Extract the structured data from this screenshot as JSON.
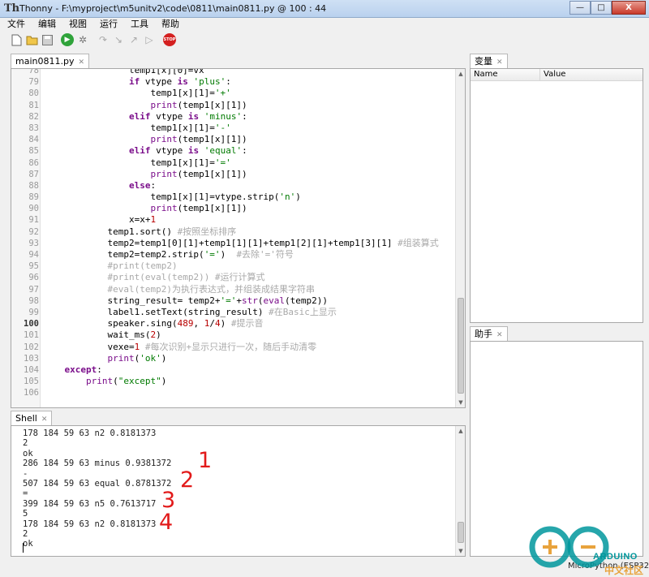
{
  "window": {
    "app_name": "Thonny",
    "title": "Thonny  -  F:\\myproject\\m5unitv2\\code\\0811\\main0811.py  @  100 : 44",
    "minimize": "—",
    "maximize": "□",
    "close": "X"
  },
  "menu": [
    "文件",
    "编辑",
    "视图",
    "运行",
    "工具",
    "帮助"
  ],
  "toolbar": {
    "new": "new-file-icon",
    "open": "open-file-icon",
    "save": "save-icon",
    "run": "run-icon",
    "debug": "debug-icon",
    "step_over": "step-over-icon",
    "step_into": "step-into-icon",
    "step_out": "step-out-icon",
    "resume": "resume-icon",
    "stop_label": "STOP"
  },
  "editor": {
    "tab_label": "main0811.py",
    "current_line": "100",
    "lines": [
      {
        "n": "78",
        "tokens": [
          [
            "plain",
            "                temp1[x][0]=vx"
          ]
        ]
      },
      {
        "n": "79",
        "tokens": [
          [
            "plain",
            "                "
          ],
          [
            "kw",
            "if"
          ],
          [
            "plain",
            " vtype "
          ],
          [
            "kw",
            "is"
          ],
          [
            "plain",
            " "
          ],
          [
            "str",
            "'plus'"
          ],
          [
            "plain",
            ":"
          ]
        ]
      },
      {
        "n": "80",
        "tokens": [
          [
            "plain",
            "                    temp1[x][1]="
          ],
          [
            "str",
            "'+'"
          ]
        ]
      },
      {
        "n": "81",
        "tokens": [
          [
            "plain",
            "                    "
          ],
          [
            "builtin",
            "print"
          ],
          [
            "plain",
            "(temp1[x][1])"
          ]
        ]
      },
      {
        "n": "82",
        "tokens": [
          [
            "plain",
            "                "
          ],
          [
            "kw",
            "elif"
          ],
          [
            "plain",
            " vtype "
          ],
          [
            "kw",
            "is"
          ],
          [
            "plain",
            " "
          ],
          [
            "str",
            "'minus'"
          ],
          [
            "plain",
            ":"
          ]
        ]
      },
      {
        "n": "83",
        "tokens": [
          [
            "plain",
            "                    temp1[x][1]="
          ],
          [
            "str",
            "'-'"
          ]
        ]
      },
      {
        "n": "84",
        "tokens": [
          [
            "plain",
            "                    "
          ],
          [
            "builtin",
            "print"
          ],
          [
            "plain",
            "(temp1[x][1])"
          ]
        ]
      },
      {
        "n": "85",
        "tokens": [
          [
            "plain",
            "                "
          ],
          [
            "kw",
            "elif"
          ],
          [
            "plain",
            " vtype "
          ],
          [
            "kw",
            "is"
          ],
          [
            "plain",
            " "
          ],
          [
            "str",
            "'equal'"
          ],
          [
            "plain",
            ":"
          ]
        ]
      },
      {
        "n": "86",
        "tokens": [
          [
            "plain",
            "                    temp1[x][1]="
          ],
          [
            "str",
            "'='"
          ]
        ]
      },
      {
        "n": "87",
        "tokens": [
          [
            "plain",
            "                    "
          ],
          [
            "builtin",
            "print"
          ],
          [
            "plain",
            "(temp1[x][1])"
          ]
        ]
      },
      {
        "n": "88",
        "tokens": [
          [
            "plain",
            "                "
          ],
          [
            "kw",
            "else"
          ],
          [
            "plain",
            ":"
          ]
        ]
      },
      {
        "n": "89",
        "tokens": [
          [
            "plain",
            "                    temp1[x][1]=vtype.strip("
          ],
          [
            "str",
            "'n'"
          ],
          [
            "plain",
            ")"
          ]
        ]
      },
      {
        "n": "90",
        "tokens": [
          [
            "plain",
            "                    "
          ],
          [
            "builtin",
            "print"
          ],
          [
            "plain",
            "(temp1[x][1])"
          ]
        ]
      },
      {
        "n": "91",
        "tokens": [
          [
            "plain",
            "                x=x+"
          ],
          [
            "num",
            "1"
          ]
        ]
      },
      {
        "n": "92",
        "tokens": [
          [
            "plain",
            "            temp1.sort() "
          ],
          [
            "cmt",
            "#按照坐标排序"
          ]
        ]
      },
      {
        "n": "93",
        "tokens": [
          [
            "plain",
            "            temp2=temp1[0][1]+temp1[1][1]+temp1[2][1]+temp1[3][1] "
          ],
          [
            "cmt",
            "#组装算式"
          ]
        ]
      },
      {
        "n": "94",
        "tokens": [
          [
            "plain",
            "            temp2=temp2.strip("
          ],
          [
            "str",
            "'='"
          ],
          [
            "plain",
            ")  "
          ],
          [
            "cmt",
            "#去除'='符号"
          ]
        ]
      },
      {
        "n": "95",
        "tokens": [
          [
            "plain",
            "            "
          ],
          [
            "cmt",
            "#print(temp2)"
          ]
        ]
      },
      {
        "n": "96",
        "tokens": [
          [
            "plain",
            "            "
          ],
          [
            "cmt",
            "#print(eval(temp2)) #运行计算式"
          ]
        ]
      },
      {
        "n": "97",
        "tokens": [
          [
            "plain",
            "            "
          ],
          [
            "cmt",
            "#eval(temp2)为执行表达式，并组装成结果字符串"
          ]
        ]
      },
      {
        "n": "98",
        "tokens": [
          [
            "plain",
            "            string_result= temp2+"
          ],
          [
            "str",
            "'='"
          ],
          [
            "plain",
            "+"
          ],
          [
            "builtin",
            "str"
          ],
          [
            "plain",
            "("
          ],
          [
            "builtin",
            "eval"
          ],
          [
            "plain",
            "(temp2))"
          ]
        ]
      },
      {
        "n": "99",
        "tokens": [
          [
            "plain",
            "            label1.setText(string_result) "
          ],
          [
            "cmt",
            "#在Basic上显示"
          ]
        ]
      },
      {
        "n": "100",
        "tokens": [
          [
            "plain",
            "            speaker.sing("
          ],
          [
            "num",
            "489"
          ],
          [
            "plain",
            ", "
          ],
          [
            "num",
            "1"
          ],
          [
            "plain",
            "/"
          ],
          [
            "num",
            "4"
          ],
          [
            "plain",
            ") "
          ],
          [
            "cmt",
            "#提示音"
          ]
        ]
      },
      {
        "n": "101",
        "tokens": [
          [
            "plain",
            "            wait_ms("
          ],
          [
            "num",
            "2"
          ],
          [
            "plain",
            ")"
          ]
        ]
      },
      {
        "n": "102",
        "tokens": [
          [
            "plain",
            "            vexe="
          ],
          [
            "num",
            "1"
          ],
          [
            "plain",
            " "
          ],
          [
            "cmt",
            "#每次识别+显示只进行一次，随后手动清零"
          ]
        ]
      },
      {
        "n": "103",
        "tokens": [
          [
            "plain",
            "            "
          ],
          [
            "builtin",
            "print"
          ],
          [
            "plain",
            "("
          ],
          [
            "str",
            "'ok'"
          ],
          [
            "plain",
            ")"
          ]
        ]
      },
      {
        "n": "104",
        "tokens": [
          [
            "plain",
            "    "
          ],
          [
            "kw",
            "except"
          ],
          [
            "plain",
            ":"
          ]
        ]
      },
      {
        "n": "105",
        "tokens": [
          [
            "plain",
            "        "
          ],
          [
            "builtin",
            "print"
          ],
          [
            "plain",
            "("
          ],
          [
            "str",
            "\"except\""
          ],
          [
            "plain",
            ")"
          ]
        ]
      },
      {
        "n": "106",
        "tokens": [
          [
            "plain",
            ""
          ]
        ]
      }
    ]
  },
  "shell": {
    "tab_label": "Shell",
    "lines": [
      "178 184 59 63 n2 0.8181373",
      "2",
      "ok",
      "286 184 59 63 minus 0.9381372",
      "-",
      "507 184 59 63 equal 0.8781372",
      "=",
      "399 184 59 63 n5 0.7613717",
      "5",
      "178 184 59 63 n2 0.8181373",
      "2",
      "ok"
    ],
    "annotations": [
      "1",
      "2",
      "3",
      "4"
    ]
  },
  "variables": {
    "tab_label": "变量",
    "col_name": "Name",
    "col_value": "Value"
  },
  "assistant": {
    "tab_label": "助手"
  },
  "status": {
    "interpreter": "MicroPython (ESP32)"
  },
  "logo": {
    "text": "ARDUINO",
    "subtext": "中文社区",
    "colors": {
      "ring": "#00979c",
      "accent": "#e8a33d"
    }
  },
  "colors": {
    "keyword": "#7a0d8a",
    "string": "#007a00",
    "number": "#b80000",
    "comment": "#a9a9a9",
    "annotation": "#e21a1a"
  }
}
